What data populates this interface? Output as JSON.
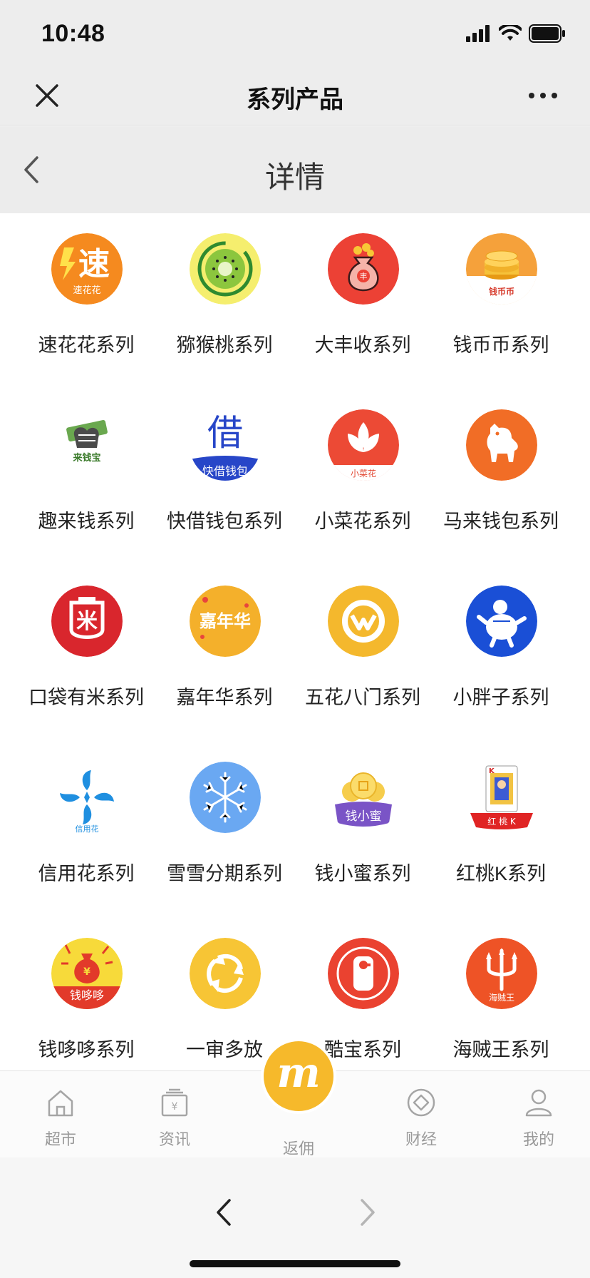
{
  "status": {
    "time": "10:48"
  },
  "wechat_nav": {
    "title": "系列产品"
  },
  "page": {
    "title": "详情"
  },
  "products": [
    {
      "label": "速花花系列",
      "icon": "su-hua-hua-logo",
      "logo_text": "速",
      "logo_subtext": "速花花"
    },
    {
      "label": "猕猴桃系列",
      "icon": "kiwi-logo"
    },
    {
      "label": "大丰收系列",
      "icon": "money-bag-logo"
    },
    {
      "label": "钱币币系列",
      "icon": "coin-stack-logo",
      "logo_subtext": "钱币币"
    },
    {
      "label": "趣来钱系列",
      "icon": "fist-cash-logo",
      "logo_subtext": "来钱宝"
    },
    {
      "label": "快借钱包系列",
      "icon": "kuai-jie-logo",
      "logo_text": "借",
      "logo_subtext": "快借钱包"
    },
    {
      "label": "小菜花系列",
      "icon": "flower-logo",
      "logo_subtext": "小菜花"
    },
    {
      "label": "马来钱包系列",
      "icon": "horse-logo"
    },
    {
      "label": "口袋有米系列",
      "icon": "rice-bag-logo",
      "logo_text": "米"
    },
    {
      "label": "嘉年华系列",
      "icon": "jia-nian-hua-logo",
      "logo_text": "嘉年华"
    },
    {
      "label": "五花八门系列",
      "icon": "gold-ring-logo"
    },
    {
      "label": "小胖子系列",
      "icon": "chubby-man-logo"
    },
    {
      "label": "信用花系列",
      "icon": "pinwheel-logo",
      "logo_subtext": "信用花"
    },
    {
      "label": "雪雪分期系列",
      "icon": "snowflake-logo"
    },
    {
      "label": "钱小蜜系列",
      "icon": "gold-coin-logo",
      "logo_subtext": "钱小蜜"
    },
    {
      "label": "红桃K系列",
      "icon": "king-card-logo",
      "logo_subtext": "红 桃 K"
    },
    {
      "label": "钱哆哆系列",
      "icon": "red-bag-logo",
      "logo_subtext": "钱哆哆"
    },
    {
      "label": "一审多放",
      "icon": "recycle-arrows-logo"
    },
    {
      "label": "酷宝系列",
      "icon": "tag-logo"
    },
    {
      "label": "海贼王系列",
      "icon": "trident-logo",
      "logo_subtext": "海贼王"
    }
  ],
  "tabs": [
    {
      "label": "超市",
      "icon": "home-icon"
    },
    {
      "label": "资讯",
      "icon": "news-icon"
    },
    {
      "label": "返佣",
      "icon": "m-logo-icon",
      "logo_text": "m"
    },
    {
      "label": "财经",
      "icon": "diamond-icon"
    },
    {
      "label": "我的",
      "icon": "user-icon"
    }
  ],
  "colors": {
    "brand_orange": "#f6b92b",
    "nav_background": "#ededed",
    "header_background": "#ececec",
    "tab_inactive": "#9a9a9a"
  }
}
